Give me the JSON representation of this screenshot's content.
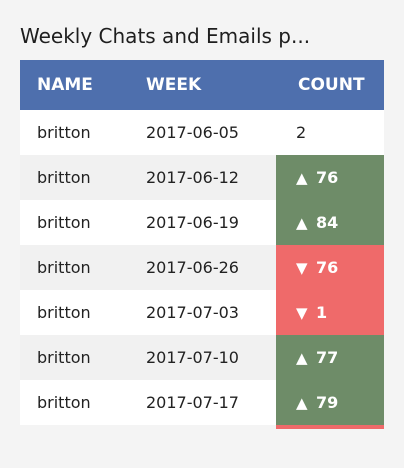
{
  "widget": {
    "title": "Weekly Chats and Emails p..."
  },
  "table": {
    "headers": [
      "NAME",
      "WEEK",
      "COUNT"
    ],
    "rows": [
      {
        "name": "britton",
        "week": "2017-06-05",
        "count": "2",
        "trend": "none"
      },
      {
        "name": "britton",
        "week": "2017-06-12",
        "count": "76",
        "trend": "up",
        "arrow": "▲"
      },
      {
        "name": "britton",
        "week": "2017-06-19",
        "count": "84",
        "trend": "up",
        "arrow": "▲"
      },
      {
        "name": "britton",
        "week": "2017-06-26",
        "count": "76",
        "trend": "down",
        "arrow": "▼"
      },
      {
        "name": "britton",
        "week": "2017-07-03",
        "count": "1",
        "trend": "down",
        "arrow": "▼"
      },
      {
        "name": "britton",
        "week": "2017-07-10",
        "count": "77",
        "trend": "up",
        "arrow": "▲"
      },
      {
        "name": "britton",
        "week": "2017-07-17",
        "count": "79",
        "trend": "up",
        "arrow": "▲"
      }
    ]
  },
  "colors": {
    "header_bg": "#4e6fad",
    "up": "#6e8c68",
    "down": "#ef6a6a"
  }
}
